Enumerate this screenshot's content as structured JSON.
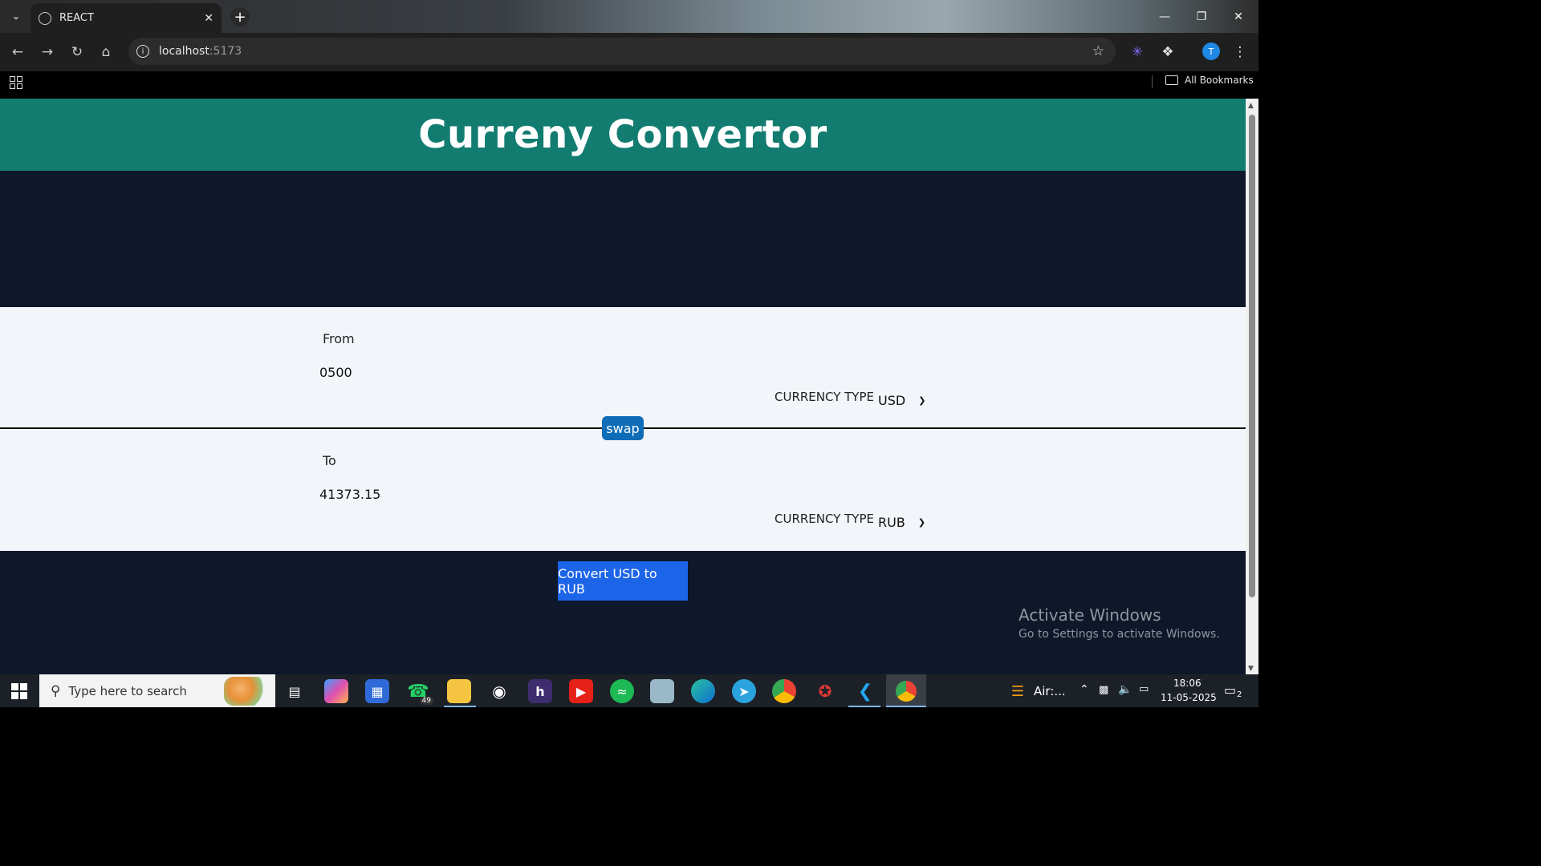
{
  "browser": {
    "tab_title": "REACT",
    "url_host": "localhost",
    "url_port": ":5173",
    "all_bookmarks": "All Bookmarks",
    "profile_initial": "T"
  },
  "app": {
    "title": "Curreny Convertor",
    "from": {
      "label": "From",
      "amount": "0500",
      "currency_type_label": "CURRENCY TYPE",
      "currency": "USD"
    },
    "swap_label": "swap",
    "to": {
      "label": "To",
      "amount": "41373.15",
      "currency_type_label": "CURRENCY TYPE",
      "currency": "RUB"
    },
    "convert_label": "Convert USD to RUB"
  },
  "watermark": {
    "title": "Activate Windows",
    "subtitle": "Go to Settings to activate Windows."
  },
  "taskbar": {
    "search_placeholder": "Type here to search",
    "whatsapp_badge": "49",
    "aircon_label": "Air:...",
    "time": "18:06",
    "date": "11-05-2025",
    "notification_count": "2"
  },
  "colors": {
    "header_bg": "#127c70",
    "page_bg": "#0f172a",
    "panel_bg": "#f2f6fa",
    "swap_bg": "#0f6db8",
    "convert_bg": "#1c64e8"
  }
}
